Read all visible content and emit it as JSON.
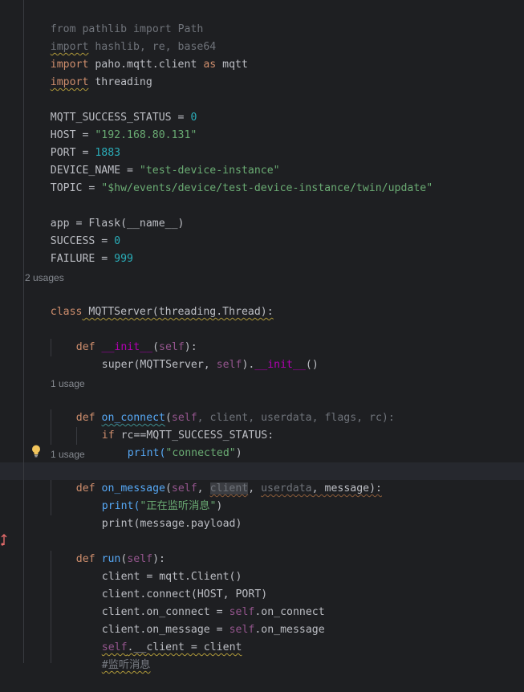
{
  "editor": {
    "lines": {
      "l0_a": "from",
      "l0_b": " pathlib ",
      "l0_c": "import",
      "l0_d": " Path",
      "l1_a": "import",
      "l1_b": " hashlib, re, base64",
      "l2_a": "import",
      "l2_b": " paho.mqtt.client ",
      "l2_c": "as",
      "l2_d": " mqtt",
      "l3_a": "import",
      "l3_b": " threading",
      "l5_a": "MQTT_SUCCESS_STATUS = ",
      "l5_b": "0",
      "l6_a": "HOST = ",
      "l6_b": "\"192.168.80.131\"",
      "l7_a": "PORT = ",
      "l7_b": "1883",
      "l8_a": "DEVICE_NAME = ",
      "l8_b": "\"test-device-instance\"",
      "l9_a": "TOPIC = ",
      "l9_b": "\"$hw/events/device/test-device-instance/twin/update\"",
      "l11": "app = Flask(__name__)",
      "l12_a": "SUCCESS = ",
      "l12_b": "0",
      "l13_a": "FAILURE = ",
      "l13_b": "999",
      "l15_a": "class",
      "l15_b": " MQTTServer(threading.Thread):",
      "l17_a": "def",
      "l17_b": "__init__",
      "l17_c": "(",
      "l17_d": "self",
      "l17_e": "):",
      "l18_a": "super(MQTTServer, ",
      "l18_b": "self",
      "l18_c": ").",
      "l18_d": "__init__",
      "l18_e": "()",
      "l20_a": "def",
      "l20_b": "on_connect",
      "l20_c": "(",
      "l20_d": "self",
      "l20_e": ", client, userdata, flags, rc):",
      "l21_a": "if",
      "l21_b": " rc==MQTT_SUCCESS_STATUS:",
      "l22_a": "print(",
      "l22_b": "\"connected\"",
      "l22_c": ")",
      "l24_a": "def",
      "l24_b": "on_message",
      "l24_c": "(",
      "l24_d": "self",
      "l24_e": ", ",
      "l24_f": "client",
      "l24_g": ", ",
      "l24_h": "userdata",
      "l24_i": ", message):",
      "l25_a": "print(",
      "l25_b": "\"正在监听消息\"",
      "l25_c": ")",
      "l26": "print(message.payload)",
      "l28_a": "def",
      "l28_b": "run",
      "l28_c": "(",
      "l28_d": "self",
      "l28_e": "):",
      "l29": "client = mqtt.Client()",
      "l30": "client.connect(HOST, PORT)",
      "l31_a": "client.on_connect = ",
      "l31_b": "self",
      "l31_c": ".on_connect",
      "l32_a": "client.on_message = ",
      "l32_b": "self",
      "l32_c": ".on_message",
      "l33_a": "self",
      "l33_b": ".__client = client",
      "l34": "#监听消息"
    },
    "hints": {
      "class_usages": "2 usages",
      "on_connect_usages": "1 usage",
      "on_message_usages": "1 usage"
    }
  },
  "colors": {
    "background": "#1e1f22",
    "keyword": "#cf8e6d",
    "string": "#6aab73",
    "number": "#2aacb8",
    "self": "#94558d",
    "function": "#56a8f5",
    "dunder": "#b200b2",
    "comment": "#7a7e85"
  },
  "icons": [
    "lightbulb-icon",
    "override-method-icon"
  ]
}
